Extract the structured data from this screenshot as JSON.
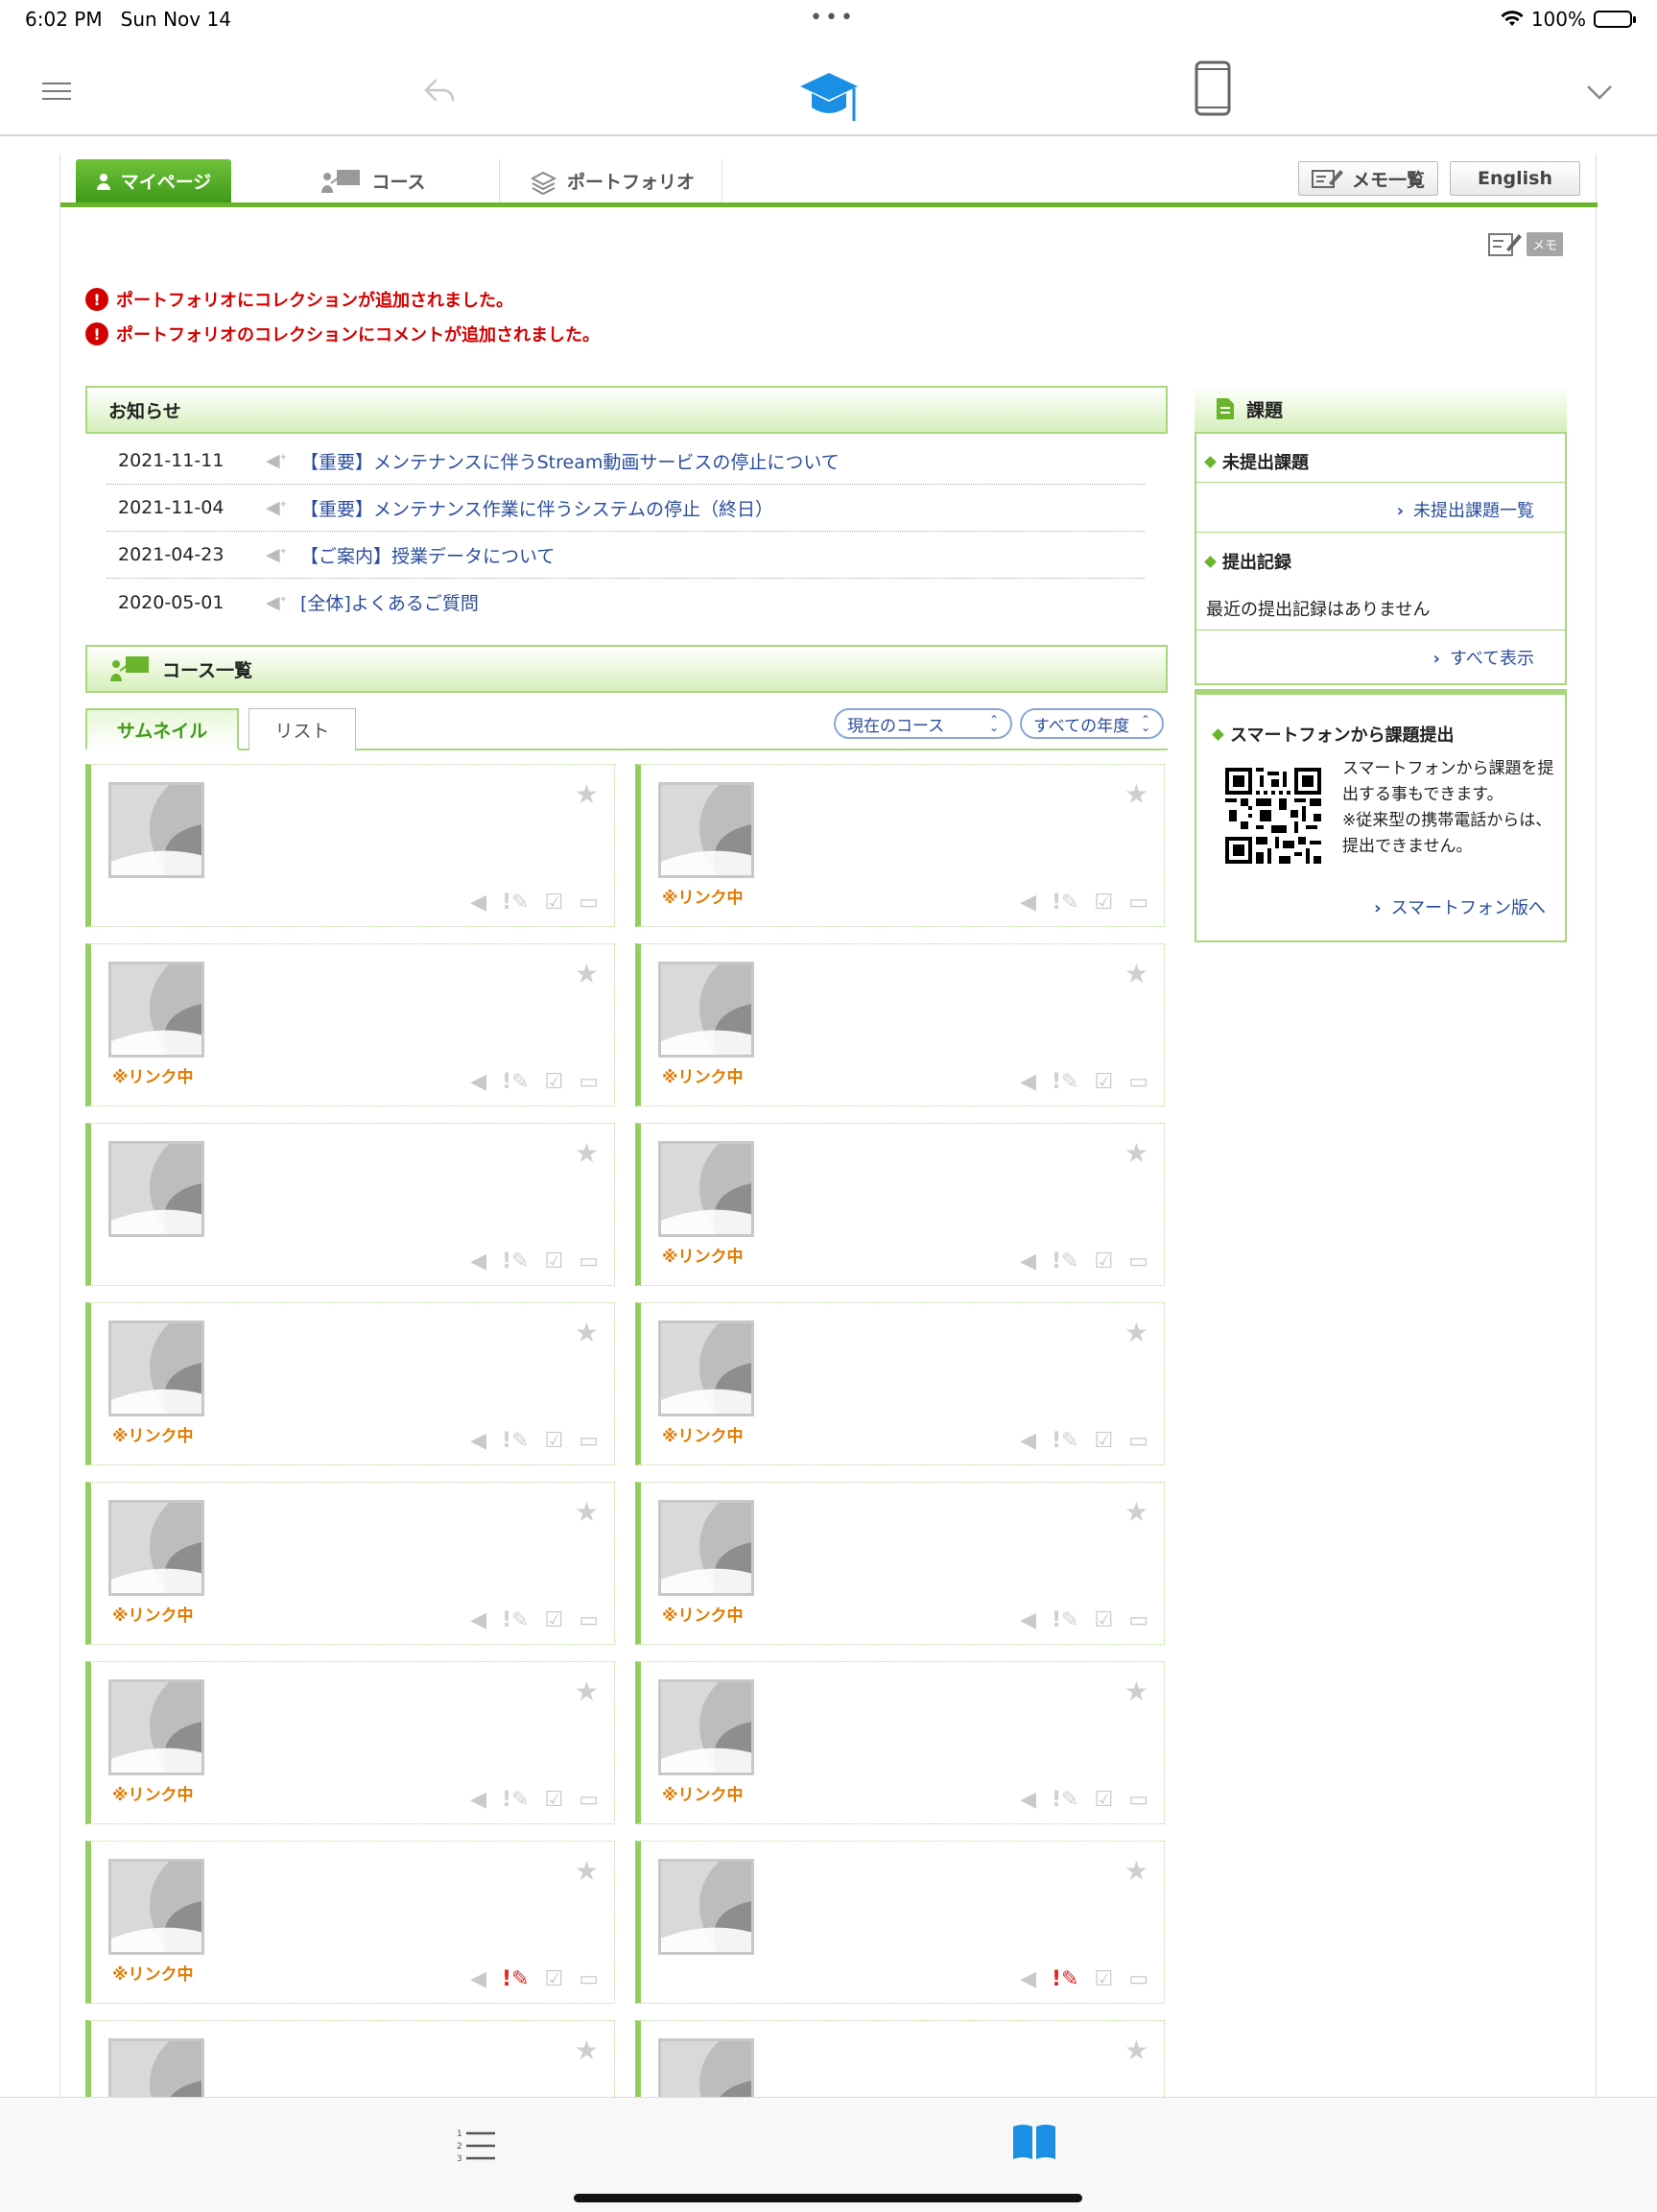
{
  "status_bar": {
    "time": "6:02 PM",
    "date": "Sun Nov 14",
    "battery": "100%"
  },
  "toolbar": {
    "menu_icon": "hamburger-menu-icon",
    "back_icon": "back-arrow-icon",
    "center_icon": "graduation-cap-icon",
    "device_icon": "smartphone-icon",
    "expand_icon": "chevron-down-icon",
    "accent_color": "#1a8fe3"
  },
  "nav": {
    "tabs": [
      {
        "label": "マイページ",
        "active": true
      },
      {
        "label": "コース"
      },
      {
        "label": "ポートフォリオ"
      }
    ],
    "memo_list": "メモ一覧",
    "english": "English",
    "memo_badge": "メモ",
    "accent_color": "#6ab52b"
  },
  "alerts": [
    "ポートフォリオにコレクションが追加されました。",
    "ポートフォリオのコレクションにコメントが追加されました。"
  ],
  "news": {
    "title": "お知らせ",
    "items": [
      {
        "date": "2021-11-11",
        "text": "【重要】メンテナンスに伴うStream動画サービスの停止について"
      },
      {
        "date": "2021-11-04",
        "text": "【重要】メンテナンス作業に伴うシステムの停止（終日）"
      },
      {
        "date": "2021-04-23",
        "text": "【ご案内】授業データについて"
      },
      {
        "date": "2020-05-01",
        "text": "[全体]よくあるご質問"
      }
    ]
  },
  "courses": {
    "title": "コース一覧",
    "view_tabs": {
      "thumbnail": "サムネイル",
      "list": "リスト"
    },
    "filter_current": "現在のコース",
    "filter_year": "すべての年度",
    "link_label": "※リンク中",
    "cards": [
      {
        "linked": false,
        "alert": false
      },
      {
        "linked": true,
        "alert": false
      },
      {
        "linked": true,
        "alert": false
      },
      {
        "linked": true,
        "alert": false
      },
      {
        "linked": false,
        "alert": false
      },
      {
        "linked": true,
        "alert": false
      },
      {
        "linked": true,
        "alert": false
      },
      {
        "linked": true,
        "alert": false
      },
      {
        "linked": true,
        "alert": false
      },
      {
        "linked": true,
        "alert": false
      },
      {
        "linked": true,
        "alert": false
      },
      {
        "linked": true,
        "alert": false
      },
      {
        "linked": true,
        "alert": true
      },
      {
        "linked": false,
        "alert": true
      },
      {
        "linked": false,
        "alert": false
      },
      {
        "linked": false,
        "alert": false
      }
    ]
  },
  "assignments": {
    "title": "課題",
    "unsubmitted_title": "未提出課題",
    "unsubmitted_link": "未提出課題一覧",
    "history_title": "提出記録",
    "history_empty": "最近の提出記録はありません",
    "show_all": "すべて表示"
  },
  "smartphone": {
    "title": "スマートフォンから課題提出",
    "desc1": "スマートフォンから課題を提出する事もできます。",
    "desc2": "※従来型の携帯電話からは、提出できません。",
    "link": "スマートフォン版へ"
  },
  "bottom_bar": {
    "left_icon": "numbered-list-icon",
    "right_icon": "open-book-icon"
  }
}
